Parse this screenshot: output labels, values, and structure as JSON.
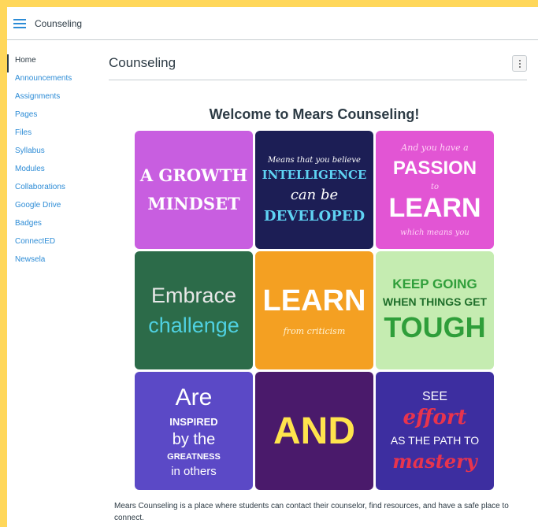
{
  "topbar": {
    "title": "Counseling"
  },
  "sidebar": {
    "items": [
      {
        "label": "Home"
      },
      {
        "label": "Announcements"
      },
      {
        "label": "Assignments"
      },
      {
        "label": "Pages"
      },
      {
        "label": "Files"
      },
      {
        "label": "Syllabus"
      },
      {
        "label": "Modules"
      },
      {
        "label": "Collaborations"
      },
      {
        "label": "Google Drive"
      },
      {
        "label": "Badges"
      },
      {
        "label": "ConnectED"
      },
      {
        "label": "Newsela"
      }
    ]
  },
  "main": {
    "title": "Counseling",
    "welcome": "Welcome to Mears Counseling!",
    "description": "Mears Counseling is a place where students can contact their counselor, find resources, and have a safe place to connect."
  },
  "poster": {
    "t1": {
      "line1": "A GROWTH",
      "line2": "MINDSET"
    },
    "t2": {
      "line1": "Means that you believe",
      "line2": "INTELLIGENCE",
      "line3": "can be",
      "line4": "DEVELOPED"
    },
    "t3": {
      "line1": "And you have a",
      "line2": "PASSION",
      "line3": "to",
      "line4": "LEARN",
      "line5": "which means you"
    },
    "t4": {
      "line1": "Embrace",
      "line2": "challenge"
    },
    "t5": {
      "line1": "LEARN",
      "line2": "from criticism"
    },
    "t6": {
      "line1": "KEEP GOING",
      "line2": "WHEN THINGS GET",
      "line3": "TOUGH"
    },
    "t7": {
      "line1": "Are",
      "line2": "INSPIRED",
      "line3": "by the",
      "line4": "GREATNESS",
      "line5": "in others"
    },
    "t8": {
      "line1": "AND"
    },
    "t9": {
      "line1": "SEE",
      "line2": "effort",
      "line3": "AS THE PATH TO",
      "line4": "mastery"
    }
  },
  "colors": {
    "link": "#2d8cd6",
    "frame": "#ffd75a"
  }
}
